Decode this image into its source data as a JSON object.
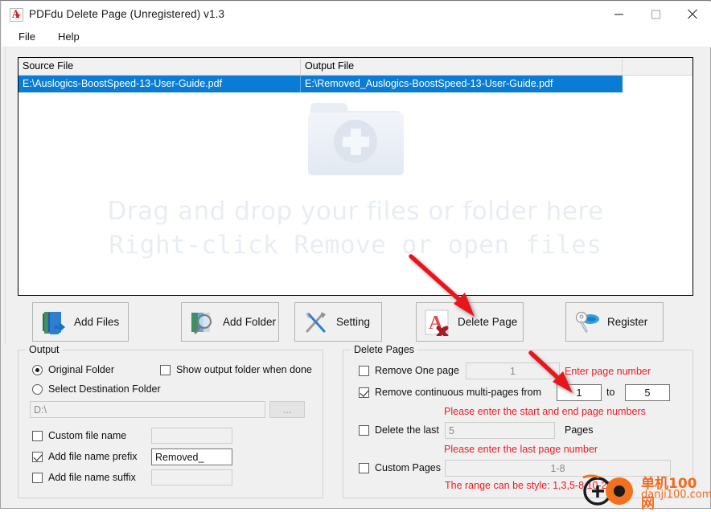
{
  "window": {
    "title": "PDFdu Delete Page (Unregistered) v1.3",
    "icon": "pdf-app-icon",
    "minimize": "minimize-icon",
    "maximize": "maximize-icon",
    "close": "close-icon"
  },
  "menu": {
    "items": [
      {
        "label": "File"
      },
      {
        "label": "Help"
      }
    ]
  },
  "file_list": {
    "columns": [
      "Source File",
      "Output File"
    ],
    "rows": [
      {
        "source": "E:\\Auslogics-BoostSpeed-13-User-Guide.pdf",
        "output": "E:\\Removed_Auslogics-BoostSpeed-13-User-Guide.pdf",
        "selected": true
      }
    ],
    "watermark": {
      "icon": "folder-plus-icon",
      "line1": "Drag and drop your files or folder here",
      "line2": "Right-click Remove or open files"
    }
  },
  "toolbar": {
    "buttons": [
      {
        "label": "Add Files",
        "icon": "add-files-icon"
      },
      {
        "label": "Add Folder",
        "icon": "add-folder-icon"
      },
      {
        "label": "Setting",
        "icon": "setting-icon"
      },
      {
        "label": "Delete Page",
        "icon": "delete-page-icon"
      },
      {
        "label": "Register",
        "icon": "register-key-icon"
      }
    ]
  },
  "output_group": {
    "title": "Output",
    "original_folder": {
      "label": "Original Folder",
      "checked": true
    },
    "select_destination": {
      "label": "Select Destination Folder",
      "checked": false
    },
    "show_output_folder": {
      "label": "Show output folder when done",
      "checked": false
    },
    "destination_path": {
      "value": "",
      "placeholder": "D:\\"
    },
    "browse_label": "...",
    "custom_file_name": {
      "label": "Custom file name",
      "checked": false,
      "value": ""
    },
    "add_prefix": {
      "label": "Add file name prefix",
      "checked": true,
      "value": "Removed_"
    },
    "add_suffix": {
      "label": "Add file name suffix",
      "checked": false,
      "value": ""
    }
  },
  "delete_group": {
    "title": "Delete Pages",
    "remove_one": {
      "label": "Remove One page",
      "checked": false,
      "value": "",
      "placeholder": "1"
    },
    "hint_one": "Enter page number",
    "remove_continuous": {
      "label": "Remove continuous multi-pages  from",
      "checked": true,
      "from": "1",
      "to_label": "to",
      "to": "5"
    },
    "hint_continuous": "Please enter the start and end page numbers",
    "delete_last": {
      "label": "Delete the last",
      "checked": false,
      "value": "",
      "placeholder": "5",
      "unit": "Pages"
    },
    "hint_last": "Please enter the last page number",
    "custom_pages": {
      "label": "Custom Pages",
      "checked": false,
      "value": "",
      "placeholder": "1-8"
    },
    "hint_custom": "The range can be style:  1,3,5-8,10-20"
  },
  "annotations": {
    "arrow_to_delete_page": "red-arrow-icon",
    "arrow_to_from_field": "red-arrow-icon"
  },
  "brand_watermark": {
    "cn": "单机100网",
    "en": "danji100.com",
    "logo": "danji-logo-icon"
  },
  "colors": {
    "selection_blue": "#0a7cd4",
    "hint_red": "#ed1c24",
    "brand_orange": "#f06b1e",
    "window_bg": "#f0f0f0"
  }
}
